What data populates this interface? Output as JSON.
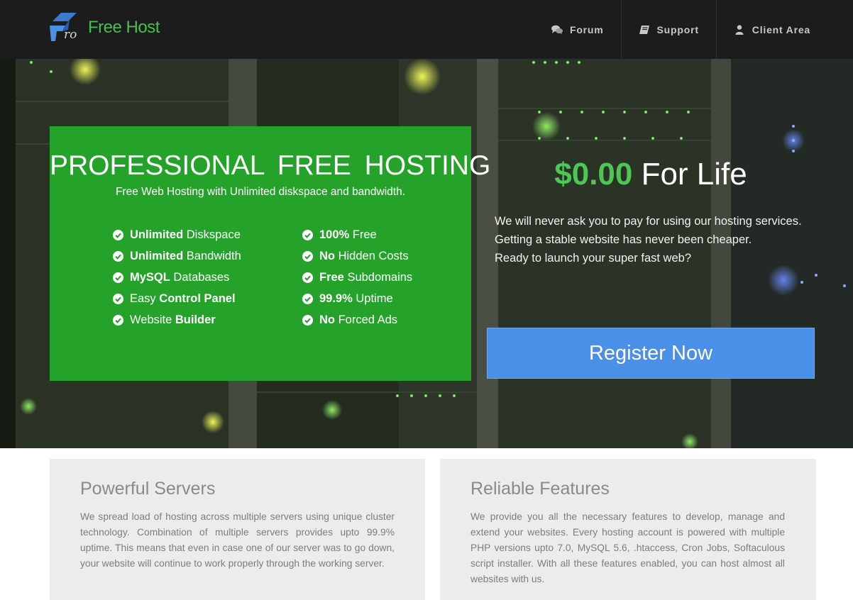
{
  "header": {
    "logo_text": "Free Host",
    "logo_mark_text": "ro",
    "nav": [
      {
        "label": "Forum",
        "icon": "comments-icon"
      },
      {
        "label": "Support",
        "icon": "book-icon"
      },
      {
        "label": "Client Area",
        "icon": "user-icon"
      }
    ]
  },
  "hero": {
    "title": "PROFESSIONAL FREE HOSTING",
    "subtitle": "Free Web Hosting with Unlimited diskspace and bandwidth.",
    "features_left": [
      {
        "bold": "Unlimited",
        "rest": " Diskspace"
      },
      {
        "bold": "Unlimited",
        "rest": " Bandwidth"
      },
      {
        "bold": "MySQL",
        "rest": " Databases"
      },
      {
        "pre": "Easy ",
        "bold": "Control Panel"
      },
      {
        "pre": "Website ",
        "bold": "Builder"
      }
    ],
    "features_right": [
      {
        "bold": "100%",
        "rest": " Free"
      },
      {
        "bold": "No",
        "rest": " Hidden Costs"
      },
      {
        "bold": "Free",
        "rest": " Subdomains"
      },
      {
        "bold": "99.9%",
        "rest": " Uptime"
      },
      {
        "bold": "No",
        "rest": " Forced Ads"
      }
    ],
    "price_amount": "$0.00",
    "price_suffix": " For Life",
    "pitch_lines": [
      "We will never ask you to pay for using our hosting services.",
      "Getting a stable website has never been cheaper.",
      "Ready to launch your super fast web?"
    ],
    "register_label": "Register Now"
  },
  "panels": [
    {
      "title": "Powerful Servers",
      "body": "We spread load of hosting across multiple servers using unique cluster technology. Combination of multiple servers provides upto 99.9% uptime. This means that even in case one of our server was to go down, your website will continue to work properly through the working server."
    },
    {
      "title": "Reliable Features",
      "body": "We provide you all the necessary features to develop, manage and extend your websites. Every hosting account is powered with multiple PHP versions upto 7.0, MySQL 5.6, .htaccess, Cron Jobs, Softaculous script installer. With all these features enabled, you can host almost all websites with us."
    }
  ],
  "colors": {
    "header_bg": "#1c1c1c",
    "brand_green": "#46c04c",
    "feature_box": "#25a22a",
    "register_blue": "#4a8fe8",
    "panel_bg": "#ececec"
  }
}
